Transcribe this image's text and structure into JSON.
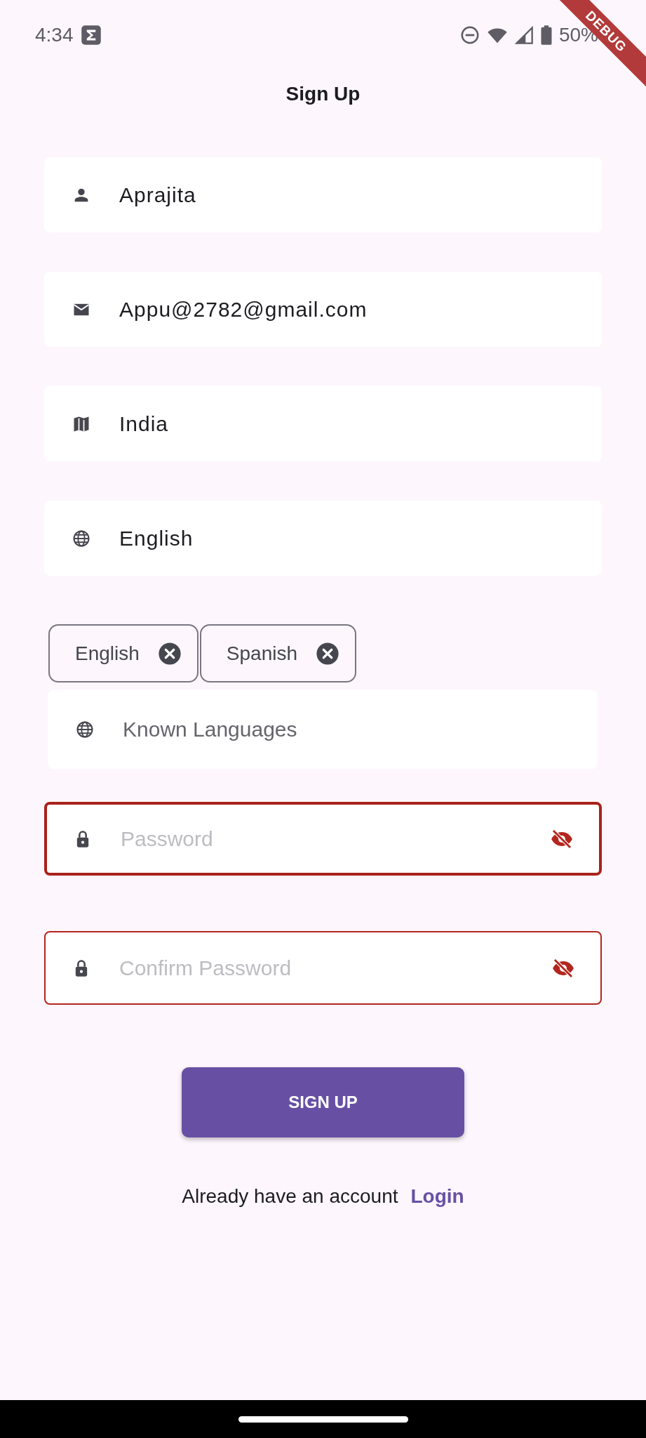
{
  "status_bar": {
    "time": "4:34",
    "battery": "50%"
  },
  "debug_banner": "DEBUG",
  "title": "Sign Up",
  "fields": [
    {
      "value": "Aprajita"
    },
    {
      "value": "Appu@2782@gmail.com"
    },
    {
      "value": "India"
    },
    {
      "value": "English"
    }
  ],
  "known_languages": {
    "chips": [
      {
        "label": "English"
      },
      {
        "label": "Spanish"
      }
    ],
    "placeholder": "Known Languages"
  },
  "password_fields": [
    {
      "placeholder": "Password",
      "error": true,
      "focused": true
    },
    {
      "placeholder": "Confirm Password",
      "error": true,
      "focused": false
    }
  ],
  "submit_button": "SIGN UP",
  "footer": {
    "text": "Already have an account",
    "link": "Login"
  }
}
